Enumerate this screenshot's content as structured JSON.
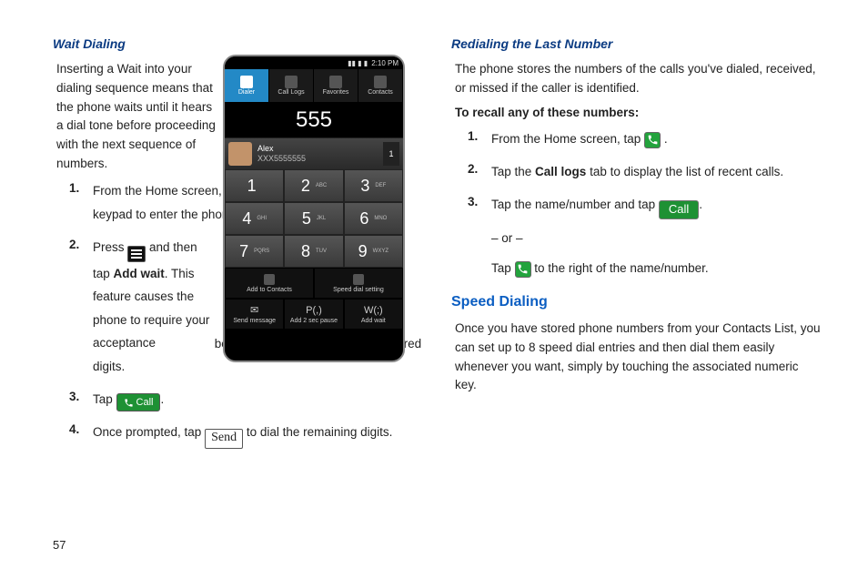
{
  "left": {
    "heading": "Wait Dialing",
    "intro": "Inserting a Wait into your dialing sequence means that the phone waits until it hears a dial tone before proceeding with the next sequence of numbers.",
    "steps": [
      {
        "num": "1.",
        "pre": "From the Home screen, tap ",
        "post": " and use the on-screen keypad to enter the phone number."
      },
      {
        "num": "2.",
        "pre": "Press ",
        "mid": " and then tap ",
        "bold1": "Add wait",
        "post2": ". This feature causes the phone to require your acceptance before sending the next set of entered digits."
      },
      {
        "num": "3.",
        "pre": "Tap "
      },
      {
        "num": "4.",
        "pre": "Once prompted, tap ",
        "post": " to dial the remaining digits."
      }
    ],
    "call_label": "Call",
    "send_label": "Send"
  },
  "right": {
    "heading1": "Redialing the Last Number",
    "intro1": "The phone stores the numbers of the calls you've dialed, received, or missed if the caller is identified.",
    "recall_head": "To recall any of these numbers:",
    "steps": [
      {
        "num": "1.",
        "pre": "From the Home screen, tap ",
        "post": " ."
      },
      {
        "num": "2.",
        "pre": "Tap the ",
        "bold1": "Call logs",
        "post": " tab to display the list of recent calls."
      },
      {
        "num": "3.",
        "pre": "Tap the name/number and tap ",
        "post": ".",
        "or": "– or –",
        "alt_pre": "Tap ",
        "alt_post": " to the right of the name/number."
      }
    ],
    "call_label": "Call",
    "heading2": "Speed Dialing",
    "para2": "Once you have stored phone numbers from your Contacts List, you can set up to 8 speed dial entries and then dial them easily whenever you want, simply by touching the associated numeric key."
  },
  "phone": {
    "time": "2:10 PM",
    "tabs": [
      "Dialer",
      "Call Logs",
      "Favorites",
      "Contacts"
    ],
    "display": "555",
    "contact_name": "Alex",
    "contact_num": "XXX5555555",
    "contact_count": "1",
    "keys": [
      {
        "d": "1",
        "l": ""
      },
      {
        "d": "2",
        "l": "ABC"
      },
      {
        "d": "3",
        "l": "DEF"
      },
      {
        "d": "4",
        "l": "GHI"
      },
      {
        "d": "5",
        "l": "JKL"
      },
      {
        "d": "6",
        "l": "MNO"
      },
      {
        "d": "7",
        "l": "PQRS"
      },
      {
        "d": "8",
        "l": "TUV"
      },
      {
        "d": "9",
        "l": "WXYZ"
      }
    ],
    "actions_top": [
      "Add to Contacts",
      "Speed dial setting"
    ],
    "actions_bot": [
      "Send message",
      "Add 2 sec pause",
      "Add wait"
    ],
    "bot_codes": [
      "✉",
      "P(,)",
      "W(;)"
    ]
  },
  "page_num": "57"
}
